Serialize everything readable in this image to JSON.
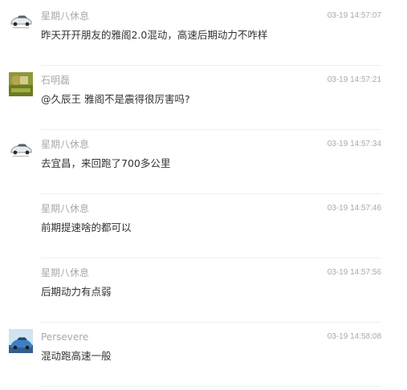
{
  "comments": [
    {
      "user": "星期八休息",
      "time": "03-19 14:57:07",
      "text": "昨天开开朋友的雅阁2.0混动，高速后期动力不咋样",
      "avatar": "car-icon"
    },
    {
      "user": "石明磊",
      "time": "03-19 14:57:21",
      "text": "@久辰王 雅阁不是震得很厉害吗?",
      "avatar": "landscape-icon"
    },
    {
      "user": "星期八休息",
      "time": "03-19 14:57:34",
      "text": "去宜昌，来回跑了700多公里",
      "avatar": "car-icon"
    },
    {
      "user": "星期八休息",
      "time": "03-19 14:57:46",
      "text": "前期提速啥的都可以",
      "avatar": "none"
    },
    {
      "user": "星期八休息",
      "time": "03-19 14:57:56",
      "text": "后期动力有点弱",
      "avatar": "none"
    },
    {
      "user": "Persevere",
      "time": "03-19 14:58:08",
      "text": "混动跑高速一般",
      "avatar": "blue-car-icon"
    }
  ]
}
